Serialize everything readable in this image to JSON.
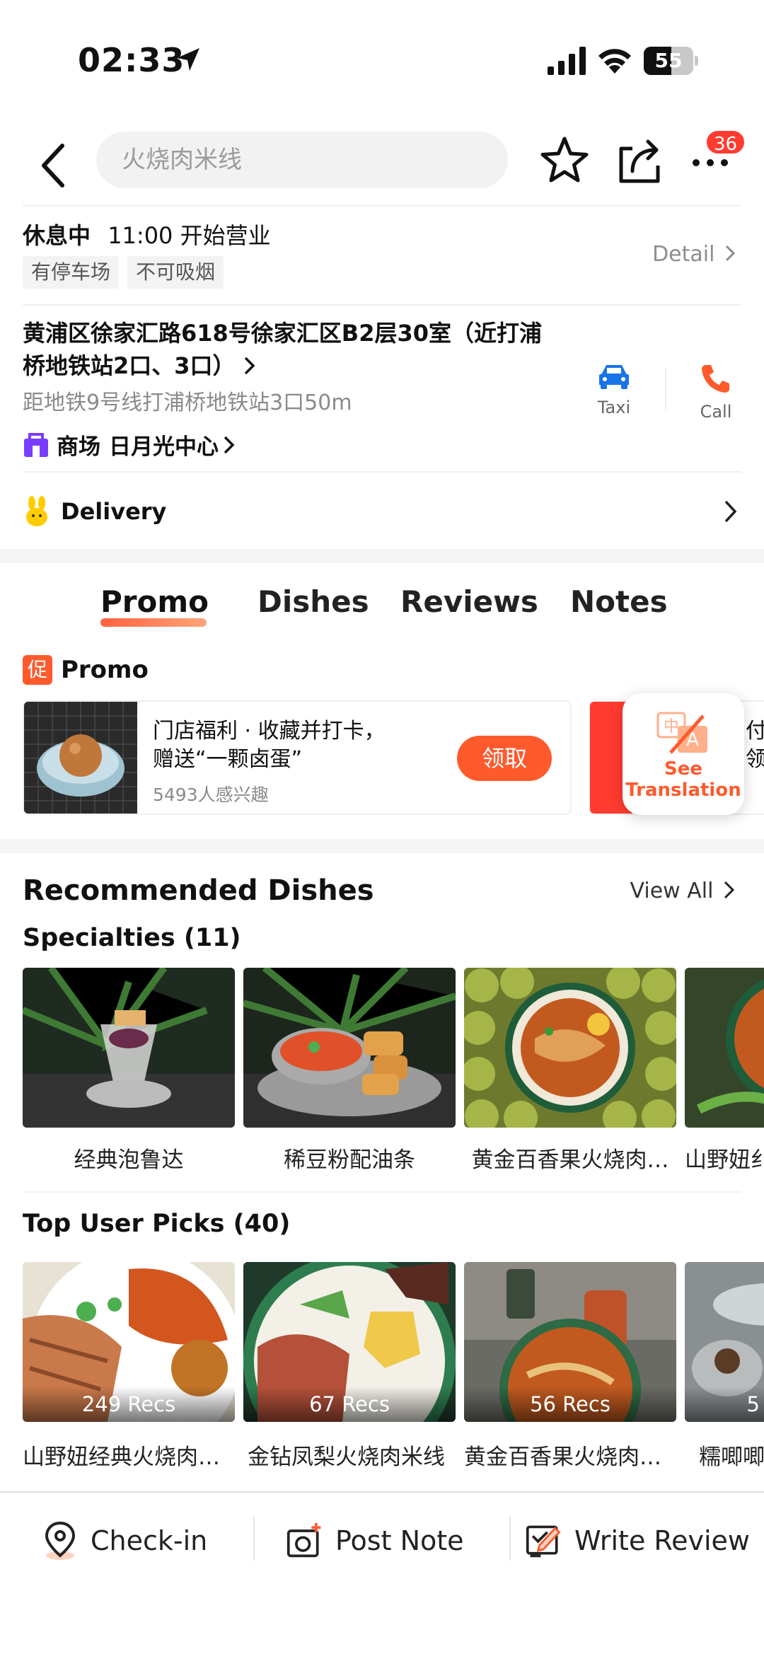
{
  "status_bar": {
    "time": "02:33",
    "battery": "55",
    "battery_level": 0.55
  },
  "header": {
    "search_placeholder": "火烧肉米线",
    "notification_count": "36"
  },
  "info": {
    "status": "休息中",
    "hours": "11:00 开始营业",
    "tags": [
      "有停车场",
      "不可吸烟"
    ],
    "detail": "Detail",
    "address_line1": "黄浦区徐家汇路618号徐家汇区B2层30室（近打浦",
    "address_line2": "桥地铁站2口、3口）",
    "metro": "距地铁9号线打浦桥地铁站3口50m",
    "mall_type": "商场",
    "mall_name": "日月光中心",
    "taxi": "Taxi",
    "call": "Call"
  },
  "delivery": {
    "label": "Delivery"
  },
  "tabs": [
    {
      "label": "Promo",
      "active": true
    },
    {
      "label": "Dishes"
    },
    {
      "label": "Reviews"
    },
    {
      "label": "Notes"
    }
  ],
  "promo": {
    "badge": "促",
    "title": "Promo",
    "card_line1": "门店福利 · 收藏并打卡，",
    "card_line2": "赠送“一颗卤蛋”",
    "card_count": "5493人感兴趣",
    "claim": "领取",
    "card2_line1": "付",
    "card2_line2": "领",
    "translate_line1": "See",
    "translate_line2": "Translation"
  },
  "recommended": {
    "title": "Recommended Dishes",
    "view_all": "View All",
    "specialties_title": "Specialties (11)",
    "specialties": [
      {
        "name": "经典泡鲁达"
      },
      {
        "name": "稀豆粉配油条"
      },
      {
        "name": "黄金百香果火烧肉…"
      },
      {
        "name": "山野妞纟"
      }
    ],
    "picks_title": "Top User Picks (40)",
    "picks": [
      {
        "name": "山野妞经典火烧肉…",
        "recs": "249 Recs"
      },
      {
        "name": "金钻凤梨火烧肉米线",
        "recs": "67 Recs"
      },
      {
        "name": "黄金百香果火烧肉…",
        "recs": "56 Recs"
      },
      {
        "name": "糯唧唧",
        "recs": "5"
      }
    ]
  },
  "bottom_bar": {
    "checkin": "Check-in",
    "post_note": "Post Note",
    "write_review": "Write Review"
  },
  "colors": {
    "accent": "#ff5a2c",
    "taxi_blue": "#1a73e8",
    "badge_red": "#ff3b30"
  }
}
